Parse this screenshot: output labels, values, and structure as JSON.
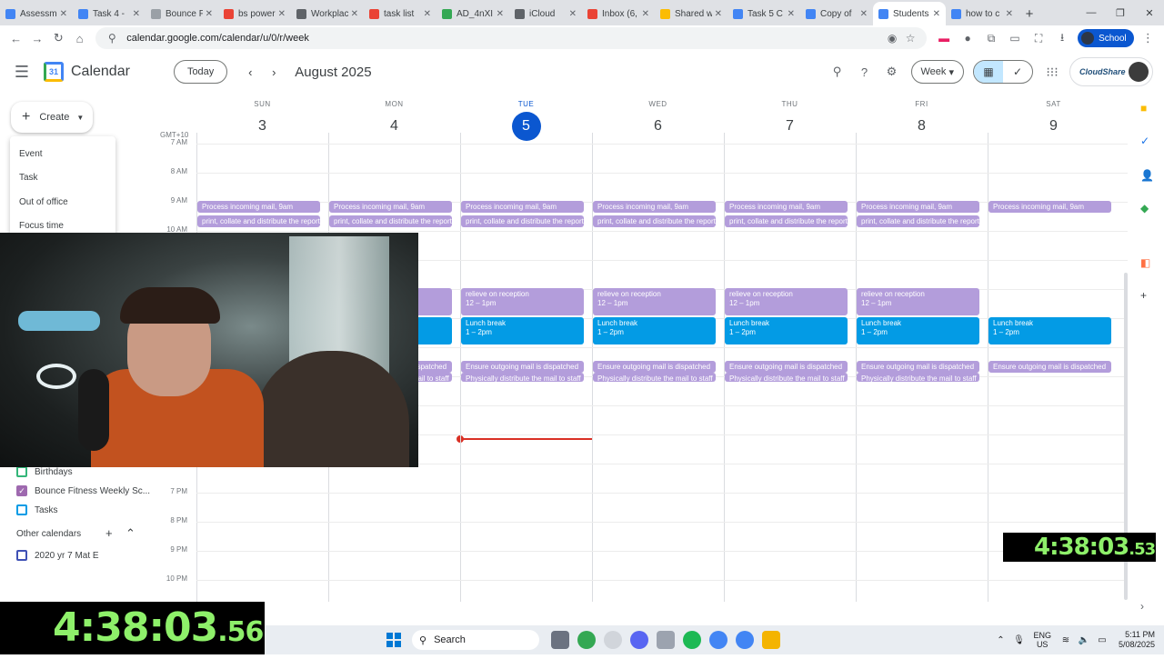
{
  "browser": {
    "tabs": [
      {
        "title": "Assessme",
        "color": "#4285f4"
      },
      {
        "title": "Task 4 -",
        "color": "#4285f4"
      },
      {
        "title": "Bounce F",
        "color": "#9aa0a6"
      },
      {
        "title": "bs power",
        "color": "#ea4335"
      },
      {
        "title": "Workplac",
        "color": "#5f6368"
      },
      {
        "title": "task list",
        "color": "#ea4335"
      },
      {
        "title": "AD_4nXI",
        "color": "#34a853"
      },
      {
        "title": "iCloud",
        "color": "#5f6368"
      },
      {
        "title": "Inbox (6,",
        "color": "#ea4335"
      },
      {
        "title": "Shared w",
        "color": "#fbbc04"
      },
      {
        "title": "Task 5 C",
        "color": "#4285f4"
      },
      {
        "title": "Copy of",
        "color": "#4285f4"
      },
      {
        "title": "Students",
        "color": "#4285f4"
      },
      {
        "title": "how to c",
        "color": "#4285f4"
      }
    ],
    "url": "calendar.google.com/calendar/u/0/r/week",
    "profile_label": "School"
  },
  "header": {
    "app_title": "Calendar",
    "today_label": "Today",
    "month": "August 2025",
    "view": "Week",
    "org_logo": "CloudShare"
  },
  "sidebar": {
    "create_label": "Create",
    "create_menu": [
      "Event",
      "Task",
      "Out of office",
      "Focus time"
    ],
    "my_calendars": [
      {
        "label": "Birthdays",
        "checked": false
      },
      {
        "label": "Bounce Fitness Weekly Sc...",
        "checked": true
      },
      {
        "label": "Tasks",
        "checked": false
      }
    ],
    "other_calendars_label": "Other calendars",
    "other_calendars": [
      {
        "label": "2020 yr 7 Mat E",
        "checked": false
      }
    ]
  },
  "grid": {
    "timezone": "GMT+10",
    "days": [
      {
        "dow": "SUN",
        "num": "3"
      },
      {
        "dow": "MON",
        "num": "4"
      },
      {
        "dow": "TUE",
        "num": "5",
        "today": true
      },
      {
        "dow": "WED",
        "num": "6"
      },
      {
        "dow": "THU",
        "num": "7"
      },
      {
        "dow": "FRI",
        "num": "8"
      },
      {
        "dow": "SAT",
        "num": "9"
      }
    ],
    "hours": [
      "7 AM",
      "8 AM",
      "9 AM",
      "10 AM",
      "7 PM",
      "8 PM",
      "9 PM",
      "10 PM"
    ],
    "events": {
      "mail_in": "Process incoming mail, 9am",
      "print": "print, collate and distribute the reports",
      "reception": "relieve on reception",
      "reception_time": "12 – 1pm",
      "lunch": "Lunch break",
      "lunch_time": "1 – 2pm",
      "mail_out": "Ensure outgoing mail is dispatched",
      "distribute": "Physically distribute the mail to staff"
    }
  },
  "overlay": {
    "timer_main": "4:38:03",
    "timer_main_frac": ".56",
    "timer_small": "4:38:03",
    "timer_small_frac": ".53"
  },
  "taskbar": {
    "search_label": "Search",
    "lang_top": "ENG",
    "lang_bottom": "US",
    "time": "5:11 PM",
    "date": "5/08/2025"
  }
}
